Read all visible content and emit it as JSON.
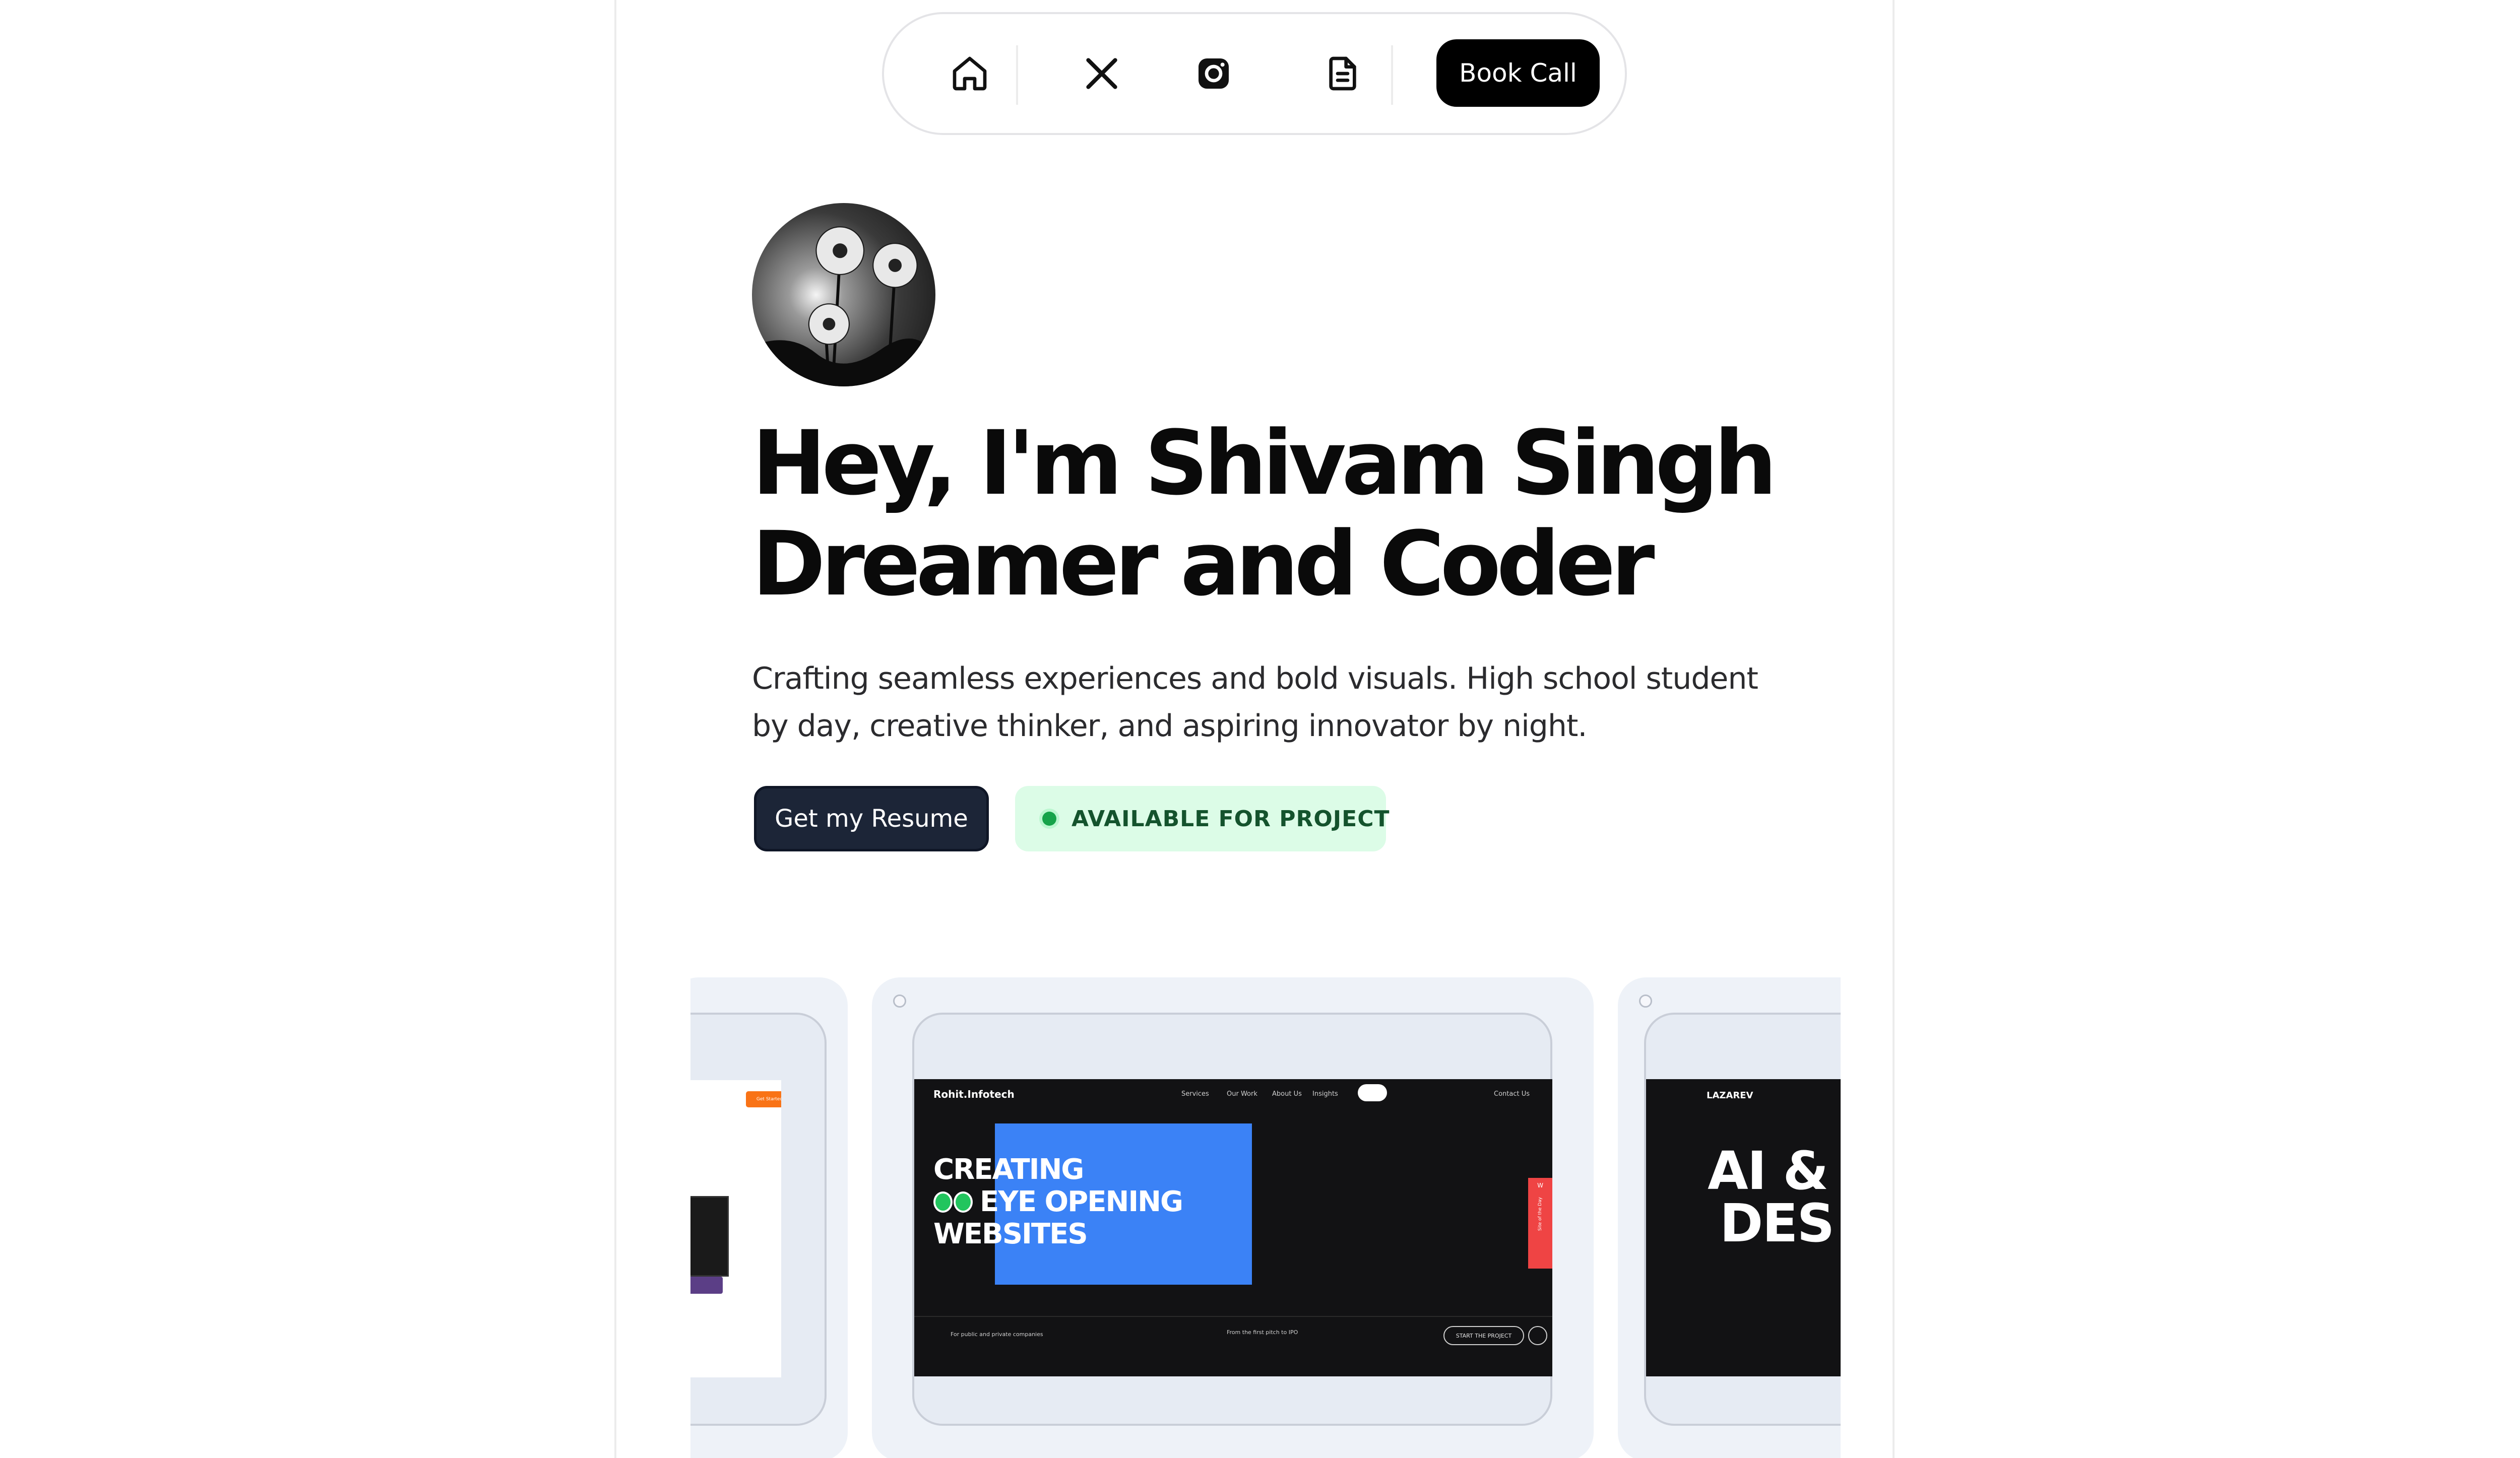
{
  "nav": {
    "icons": [
      "home-icon",
      "x-logo-icon",
      "instagram-icon",
      "document-icon"
    ],
    "book_call_label": "Book Call"
  },
  "hero": {
    "headline_line1": "Hey, I'm Shivam Singh",
    "headline_line2": "Dreamer and Coder",
    "subtitle_line1": "Crafting seamless experiences and bold visuals. High school student",
    "subtitle_line2": "by day, creative thinker, and aspiring innovator by night.",
    "resume_button": "Get my Resume",
    "status_badge": "AVAILABLE FOR PROJECT"
  },
  "projects": {
    "left_card": {
      "cta": "Get Started"
    },
    "center_card": {
      "site_logo": "Rohit.Infotech",
      "site_nav": [
        "Services",
        "Our Work",
        "About Us",
        "Insights"
      ],
      "contact": "Contact Us",
      "headline": [
        "CREATING",
        "EYE OPENING",
        "WEBSITES"
      ],
      "footer_left": "For public and private companies",
      "footer_mid": "From the first pitch to IPO",
      "footer_cta": "START THE PROJECT",
      "side_tab": "W",
      "side_tab_sub": "Site of the Day"
    },
    "right_card": {
      "site_logo": "LAZAREV",
      "headline": [
        "AI &",
        "DES"
      ]
    }
  },
  "colors": {
    "book_call_bg": "#000000",
    "resume_bg": "#1c2537",
    "available_bg": "#dcfce7",
    "available_text": "#14532d",
    "available_dot": "#16a34a",
    "card_bg": "#eef2f8",
    "showcase_blue": "#3b82f6"
  }
}
